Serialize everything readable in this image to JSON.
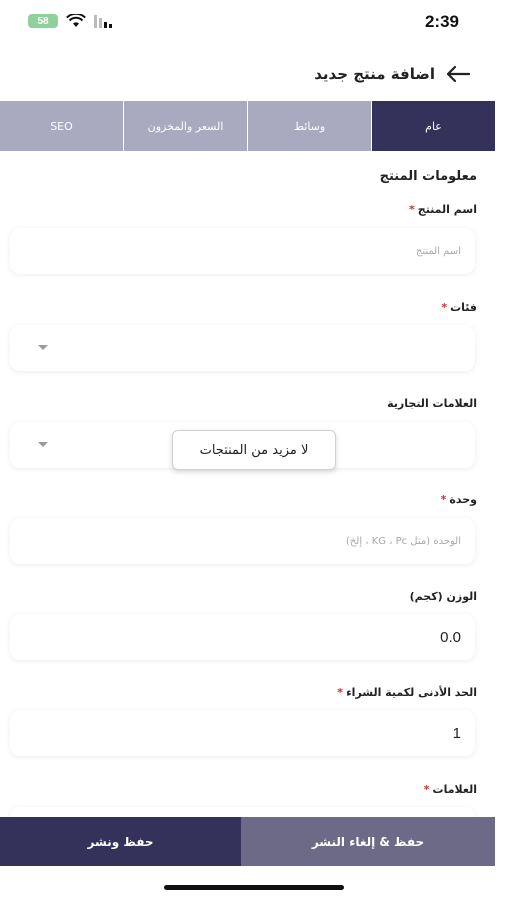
{
  "status": {
    "time": "2:39",
    "battery": "58"
  },
  "header": {
    "title": "اضافة منتج جديد"
  },
  "tabs": [
    {
      "label": "عام",
      "active": true
    },
    {
      "label": "وسائط",
      "active": false
    },
    {
      "label": "السعر والمخزون",
      "active": false
    },
    {
      "label": "SEO",
      "active": false
    }
  ],
  "form": {
    "section_title": "معلومات المنتج",
    "product_name": {
      "label": "اسم المنتج",
      "placeholder": "اسم المنتج"
    },
    "categories": {
      "label": "فئات"
    },
    "brands": {
      "label": "العلامات التجارية"
    },
    "unit": {
      "label": "وحدة",
      "placeholder": "الوحدة (مثل KG ، Pc ، إلخ)"
    },
    "weight": {
      "label": "الوزن (كجم)",
      "value": "0.0"
    },
    "min_qty": {
      "label": "الحد الأدنى لكمية الشراء",
      "value": "1"
    },
    "tags": {
      "label": "العلامات"
    },
    "required_mark": "*"
  },
  "toast": {
    "text": "لا مزيد من المنتجات"
  },
  "actions": {
    "save_unpublish": "حفظ & إلغاء النشر",
    "save_publish": "حفظ ونشر"
  },
  "colors": {
    "primary": "#34315a",
    "tab_inactive": "#a9a9bf",
    "secondary_button": "#6c6a86",
    "required": "#d32f2f"
  }
}
